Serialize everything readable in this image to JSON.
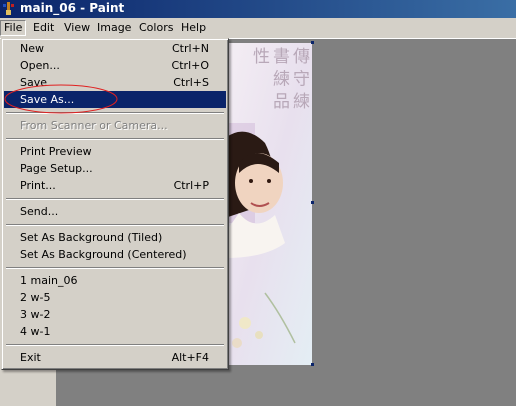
{
  "window": {
    "title": "main_06 - Paint"
  },
  "menubar": [
    "File",
    "Edit",
    "View",
    "Image",
    "Colors",
    "Help"
  ],
  "file_menu": {
    "items": [
      {
        "label": "New",
        "shortcut": "Ctrl+N"
      },
      {
        "label": "Open...",
        "shortcut": "Ctrl+O"
      },
      {
        "label": "Save",
        "shortcut": "Ctrl+S"
      },
      {
        "label": "Save As...",
        "shortcut": ""
      },
      {
        "label": "From Scanner or Camera...",
        "shortcut": ""
      },
      {
        "label": "Print Preview",
        "shortcut": ""
      },
      {
        "label": "Page Setup...",
        "shortcut": ""
      },
      {
        "label": "Print...",
        "shortcut": "Ctrl+P"
      },
      {
        "label": "Send...",
        "shortcut": ""
      },
      {
        "label": "Set As Background (Tiled)",
        "shortcut": ""
      },
      {
        "label": "Set As Background (Centered)",
        "shortcut": ""
      },
      {
        "label": "1 main_06",
        "shortcut": ""
      },
      {
        "label": "2 w-5",
        "shortcut": ""
      },
      {
        "label": "3 w-2",
        "shortcut": ""
      },
      {
        "label": "4 w-1",
        "shortcut": ""
      },
      {
        "label": "Exit",
        "shortcut": "Alt+F4"
      }
    ],
    "highlighted": "Save As...",
    "disabled": "From Scanner or Camera..."
  },
  "canvas": {
    "calligraphy_text": "傳 守 練 書 練 品 性"
  },
  "colors": {
    "highlight": "#0a246a",
    "annotation": "#e02020",
    "face": "#d4d0c8",
    "workspace": "#808080"
  }
}
